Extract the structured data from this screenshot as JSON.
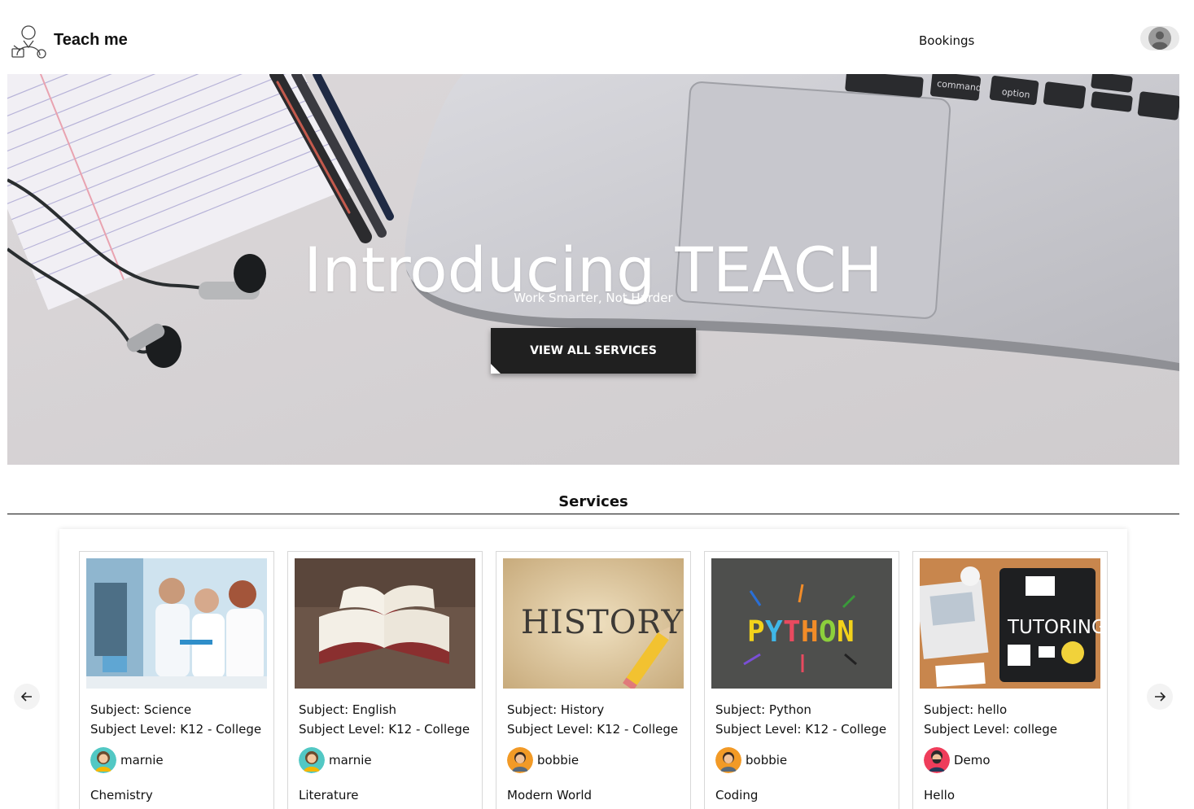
{
  "header": {
    "brand": "Teach me",
    "nav_bookings": "Bookings"
  },
  "hero": {
    "title": "Introducing TEACH",
    "subtitle": "Work Smarter, Not Harder",
    "button_label": "VIEW ALL SERVICES"
  },
  "services": {
    "heading": "Services",
    "cards": [
      {
        "subject": "Subject: Science",
        "level": "Subject Level: K12 - College",
        "tutor": "marnie",
        "topic": "Chemistry",
        "image": "science-lab-photo",
        "avatar": "female-tutor-avatar"
      },
      {
        "subject": "Subject: English",
        "level": "Subject Level: K12 - College",
        "tutor": "marnie",
        "topic": "Literature",
        "image": "open-books-photo",
        "avatar": "female-tutor-avatar"
      },
      {
        "subject": "Subject: History",
        "level": "Subject Level: K12 - College",
        "tutor": "bobbie",
        "topic": "Modern World",
        "image": "history-paper-photo",
        "avatar": "male-tutor-avatar"
      },
      {
        "subject": "Subject: Python",
        "level": "Subject Level: K12 - College",
        "tutor": "bobbie",
        "topic": "Coding",
        "image": "python-blocks-photo",
        "avatar": "male-tutor-avatar"
      },
      {
        "subject": "Subject: hello",
        "level": "Subject Level: college",
        "tutor": "Demo",
        "topic": "Hello",
        "image": "tutoring-desk-photo",
        "avatar": "bearded-tutor-avatar"
      }
    ]
  },
  "icons": {
    "logo": "teacher-logo-icon",
    "profile": "user-avatar-icon",
    "prev": "arrow-left-icon",
    "next": "arrow-right-icon"
  },
  "colors": {
    "hero_button": "#202020",
    "text": "#111111"
  }
}
